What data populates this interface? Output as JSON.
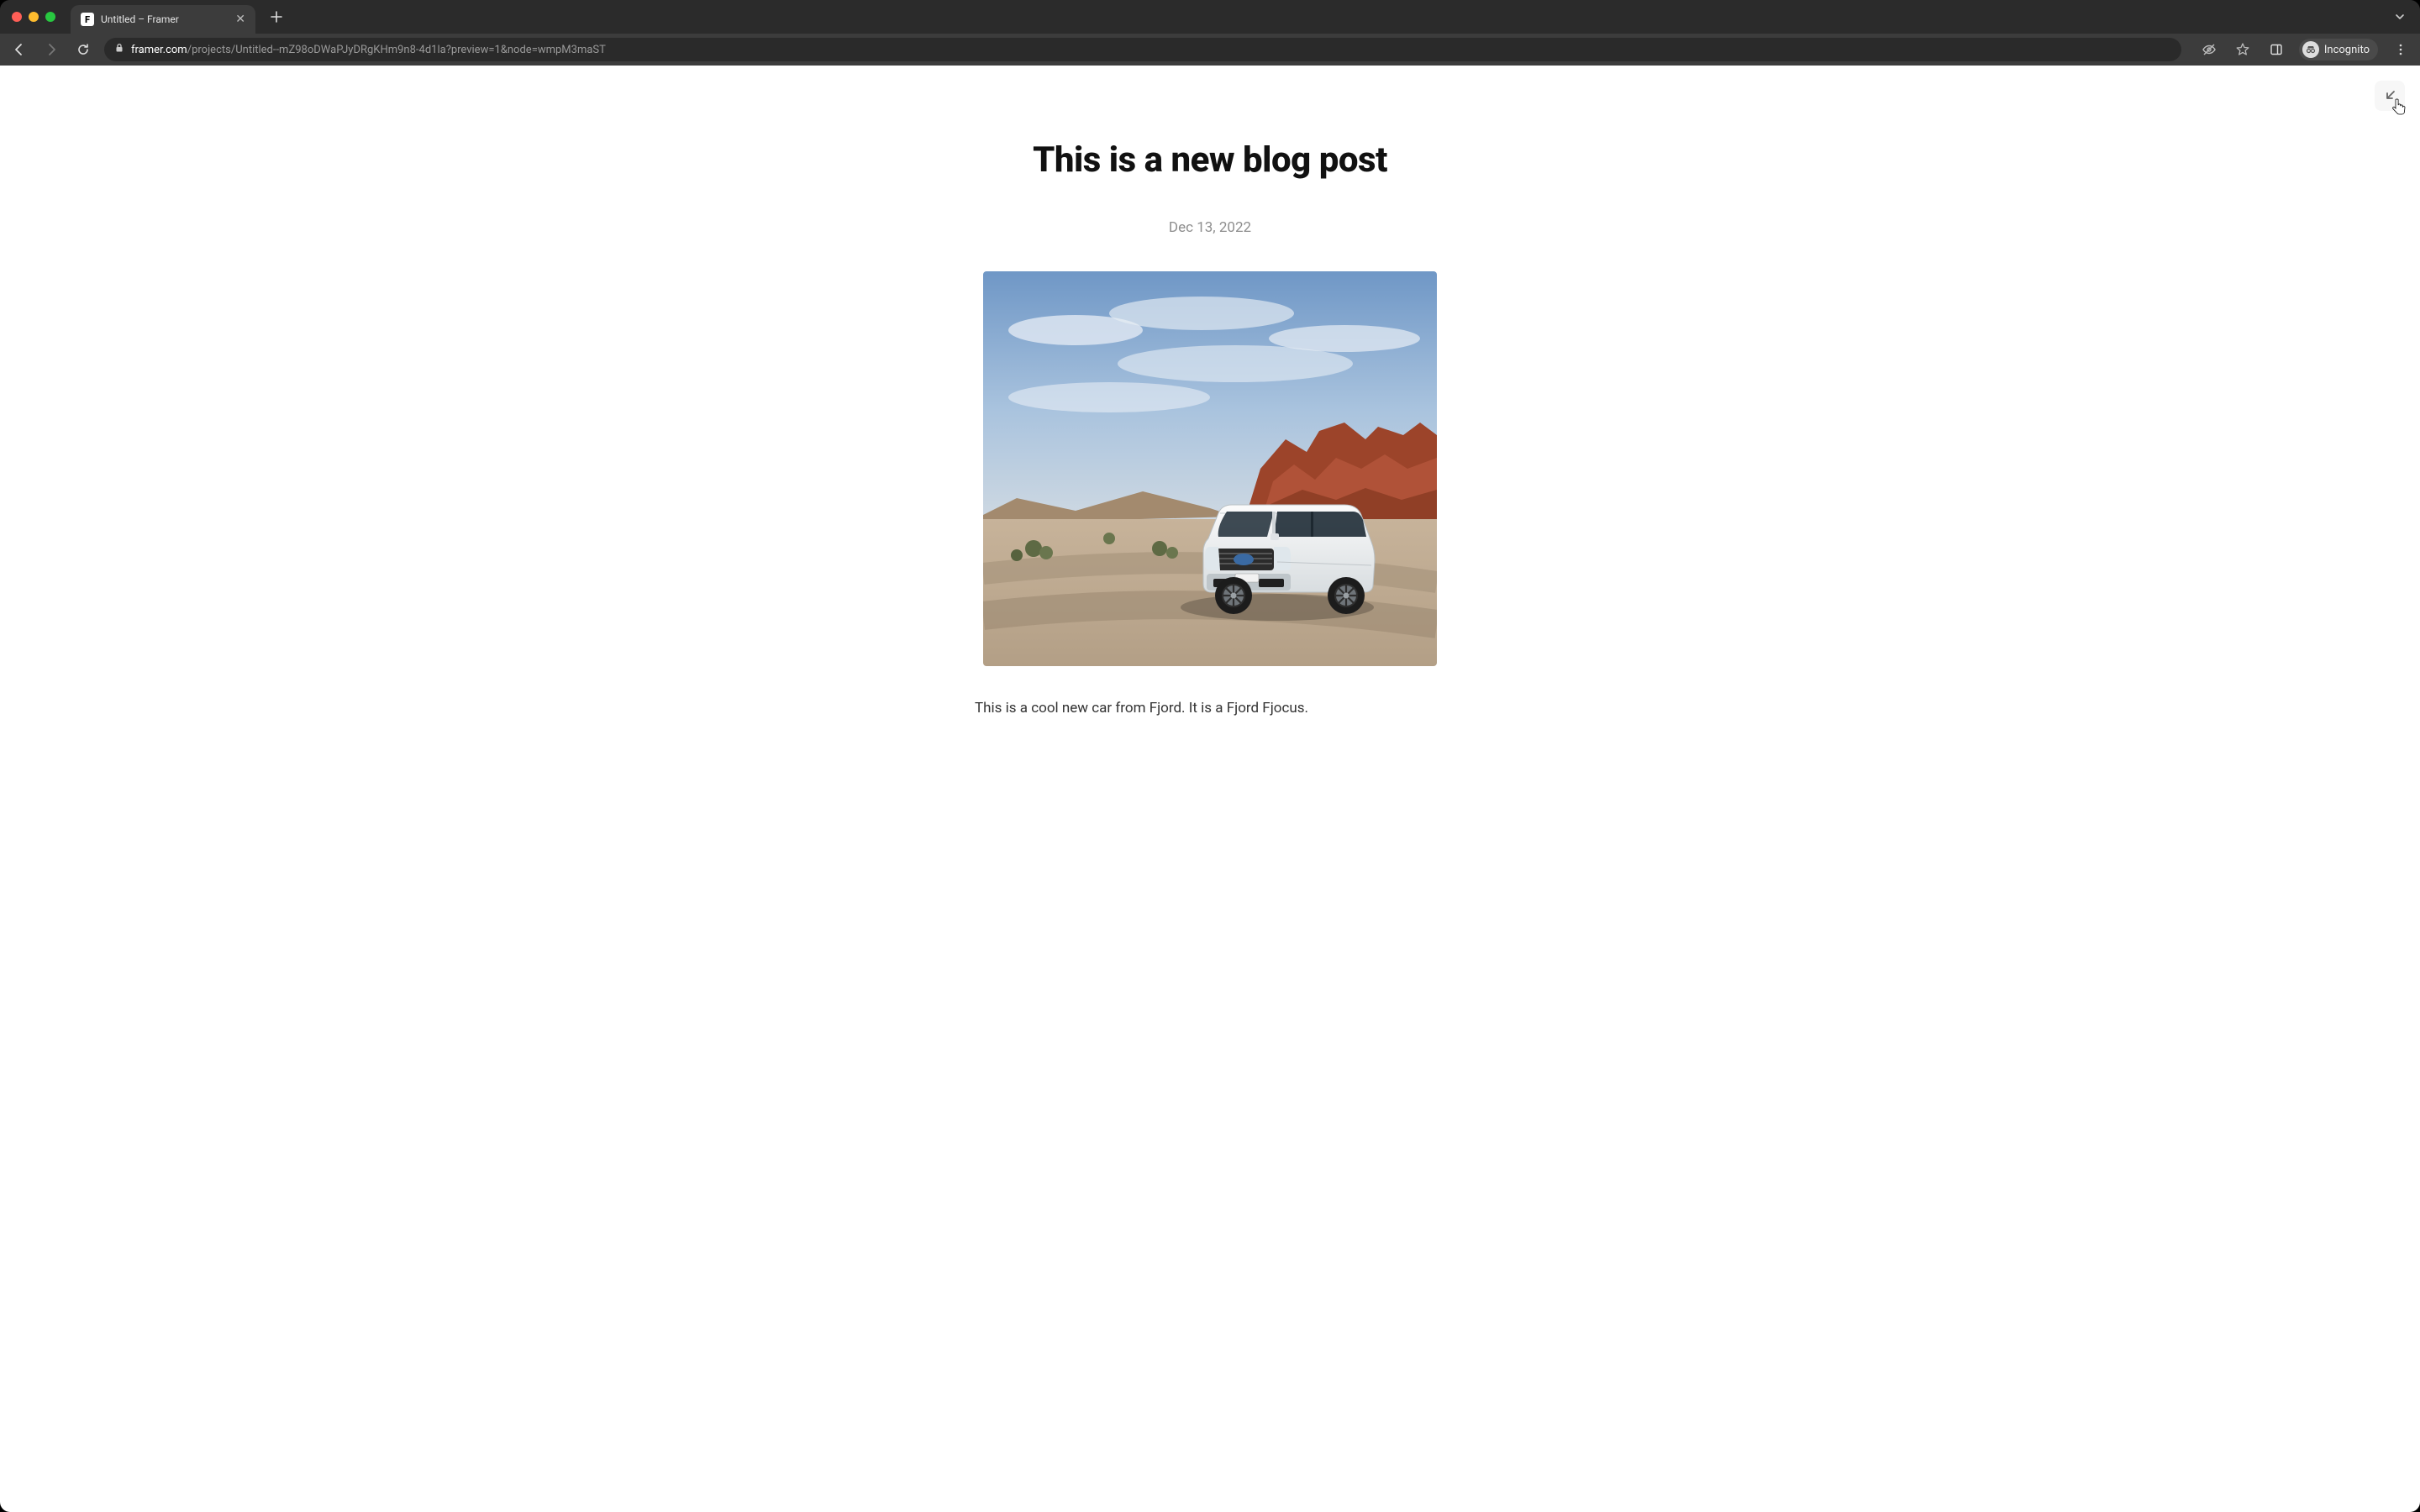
{
  "browser": {
    "tab_title": "Untitled – Framer",
    "url_domain": "framer.com",
    "url_path": "/projects/Untitled--mZ98oDWaPJyDRgKHm9n8-4d1la?preview=1&node=wmpM3maST",
    "incognito_label": "Incognito"
  },
  "page": {
    "title": "This is a new blog post",
    "date": "Dec 13, 2022",
    "body": "This is a cool new car from Fjord. It is a Fjord Fjocus.",
    "hero_alt": "White SUV on desert road with red rocks"
  }
}
